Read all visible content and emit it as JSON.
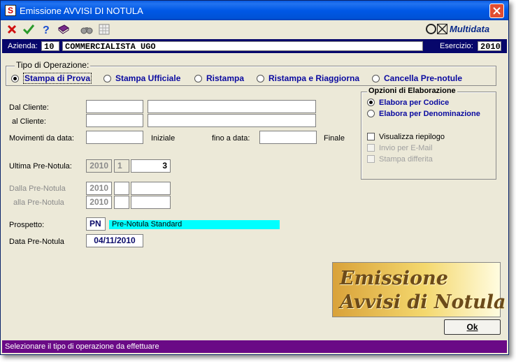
{
  "window": {
    "title": "Emissione AVVISI DI NOTULA"
  },
  "toolbar": {
    "icons": [
      "cancel-icon",
      "confirm-icon",
      "help-icon",
      "book-icon",
      "binoculars-icon",
      "grid-icon"
    ],
    "brand": "Multidata"
  },
  "company": {
    "label": "Azienda:",
    "code": "10",
    "name": "COMMERCIALISTA UGO",
    "year_label": "Esercizio:",
    "year": "2010"
  },
  "operation": {
    "legend": "Tipo di Operazione:",
    "options": [
      "Stampa di Prova",
      "Stampa Ufficiale",
      "Ristampa",
      "Ristampa e Riaggiorna",
      "Cancella Pre-notule"
    ],
    "selected": "Stampa di Prova"
  },
  "form": {
    "dal_cliente": "Dal Cliente:",
    "al_cliente": "al Cliente:",
    "mov_da_data": "Movimenti da data:",
    "iniziale": "Iniziale",
    "fino_a_data": "fino a data:",
    "finale": "Finale",
    "ultima": "Ultima Pre-Notula:",
    "ultima_year": "2010",
    "ultima_series": "1",
    "ultima_number": "3",
    "dalla": "Dalla Pre-Notula",
    "dalla_year": "2010",
    "alla": "alla Pre-Notula",
    "alla_year": "2010",
    "prospetto": "Prospetto:",
    "prospetto_code": "PN",
    "prospetto_desc": "Pre-Notula Standard",
    "data_label": "Data Pre-Notula",
    "data_value": "04/11/2010"
  },
  "options": {
    "legend": "Opzioni di Elaborazione",
    "elabora_codice": "Elabora per Codice",
    "elabora_denominazione": "Elabora per Denominazione",
    "selected": "Elabora per Codice",
    "visualizza": "Visualizza riepilogo",
    "invio_email": "Invio per E-Mail",
    "stampa_differita": "Stampa differita"
  },
  "banner": {
    "line1": "Emissione",
    "line2": "Avvisi di Notula"
  },
  "ok_label": "Ok",
  "status": "Selezionare il tipo di operazione da effettuare",
  "colors": {
    "title": "#0058e6",
    "company_bar": "#07076b",
    "status_bar": "#6a0a86",
    "accent_text": "#0a0aa0",
    "prospetto_desc_bg": "#00ffff"
  }
}
